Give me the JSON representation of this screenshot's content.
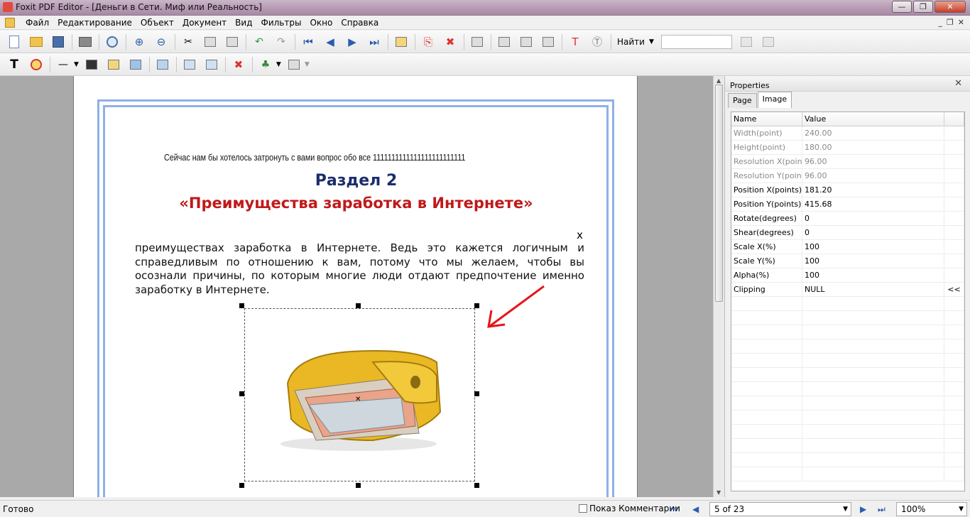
{
  "window": {
    "title": "Foxit PDF Editor - [Деньги в Сети. Миф или Реальность]",
    "minimize": "—",
    "maximize": "❐",
    "close": "✕"
  },
  "menu": {
    "items": [
      "Файл",
      "Редактирование",
      "Объект",
      "Документ",
      "Вид",
      "Фильтры",
      "Окно",
      "Справка"
    ],
    "mdi_minimize": "_",
    "mdi_restore": "❐",
    "mdi_close": "✕"
  },
  "toolbar": {
    "find_label": "Найти",
    "find_value": ""
  },
  "document": {
    "line1": "Сейчас нам бы хотелось затронуть с вами вопрос обо все 1111111111111111111111111",
    "heading1": "Раздел 2",
    "heading2": "«Преимущества заработка в Интернете»",
    "x_mark": "x",
    "paragraph": "преимуществах заработка в Интернете. Ведь это кажется логичным и справедливым по отношению к вам, потому что мы желаем, чтобы вы осознали причины, по которым многие люди отдают предпочтение именно заработку в Интернете."
  },
  "properties": {
    "title": "Properties",
    "close": "✕",
    "tabs": [
      "Page",
      "Image"
    ],
    "active_tab": "Image",
    "columns": [
      "Name",
      "Value"
    ],
    "rows": [
      {
        "name": "Width(point)",
        "value": "240.00",
        "readonly": true
      },
      {
        "name": "Height(point)",
        "value": "180.00",
        "readonly": true
      },
      {
        "name": "Resolution X(point)",
        "value": "96.00",
        "readonly": true
      },
      {
        "name": "Resolution Y(point)",
        "value": "96.00",
        "readonly": true
      },
      {
        "name": "Position X(points)",
        "value": "181.20",
        "readonly": false
      },
      {
        "name": "Position Y(points)",
        "value": "415.68",
        "readonly": false
      },
      {
        "name": "Rotate(degrees)",
        "value": "0",
        "readonly": false
      },
      {
        "name": "Shear(degrees)",
        "value": "0",
        "readonly": false
      },
      {
        "name": "Scale X(%)",
        "value": "100",
        "readonly": false
      },
      {
        "name": "Scale Y(%)",
        "value": "100",
        "readonly": false
      },
      {
        "name": "Alpha(%)",
        "value": "100",
        "readonly": false
      },
      {
        "name": "Clipping",
        "value": "NULL",
        "readonly": false,
        "extra": "<<"
      }
    ]
  },
  "status": {
    "text": "Готово",
    "show_comments_label": "Показ Комментарии",
    "page_display": "5 of 23",
    "zoom": "100%"
  }
}
